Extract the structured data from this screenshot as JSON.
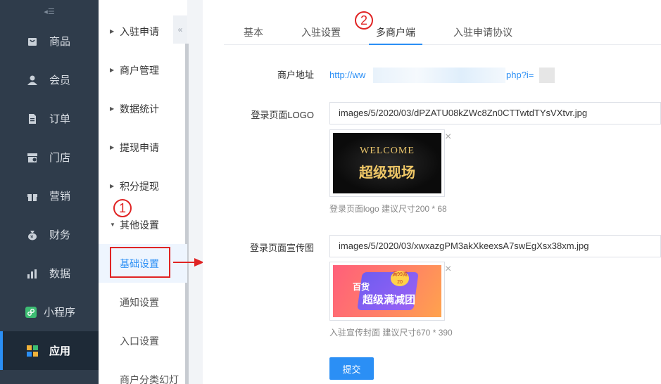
{
  "sidebar": {
    "toggle": "◂☰",
    "items": [
      {
        "label": "商品"
      },
      {
        "label": "会员"
      },
      {
        "label": "订单"
      },
      {
        "label": "门店"
      },
      {
        "label": "营销"
      },
      {
        "label": "财务"
      },
      {
        "label": "数据"
      },
      {
        "label": "小程序"
      },
      {
        "label": "应用"
      }
    ]
  },
  "submenu": {
    "collapse": "«",
    "items": [
      {
        "label": "入驻申请"
      },
      {
        "label": "商户管理"
      },
      {
        "label": "数据统计"
      },
      {
        "label": "提现申请"
      },
      {
        "label": "积分提现"
      },
      {
        "label": "其他设置"
      }
    ],
    "children": [
      {
        "label": "基础设置"
      },
      {
        "label": "通知设置"
      },
      {
        "label": "入口设置"
      },
      {
        "label": "商户分类幻灯"
      }
    ]
  },
  "annotations": {
    "badge1": "1",
    "badge2": "2"
  },
  "tabs": [
    {
      "label": "基本"
    },
    {
      "label": "入驻设置"
    },
    {
      "label": "多商户端"
    },
    {
      "label": "入驻申请协议"
    }
  ],
  "form": {
    "address_label": "商户地址",
    "address_prefix": "http://ww",
    "address_suffix": "php?i=",
    "logo_label": "登录页面LOGO",
    "logo_value": "images/5/2020/03/dPZATU08kZWc8Zn0CTTwtdTYsVXtvr.jpg",
    "logo_image_text1": "WELCOME",
    "logo_image_text2": "超级现场",
    "logo_hint": "登录页面logo 建议尺寸200 * 68",
    "promo_label": "登录页面宣传图",
    "promo_value": "images/5/2020/03/xwxazgPM3akXkeexsA7swEgXsx38xm.jpg",
    "promo_image_text1": "百货",
    "promo_image_text2": "超级满减团",
    "promo_image_badge": "满99减20",
    "promo_hint": "入驻宣传封面 建议尺寸670 * 390",
    "submit": "提交",
    "close": "×"
  },
  "colors": {
    "accent": "#2b8ff5",
    "sidebar_bg": "#2f3c4b",
    "annotation": "#e02424"
  }
}
